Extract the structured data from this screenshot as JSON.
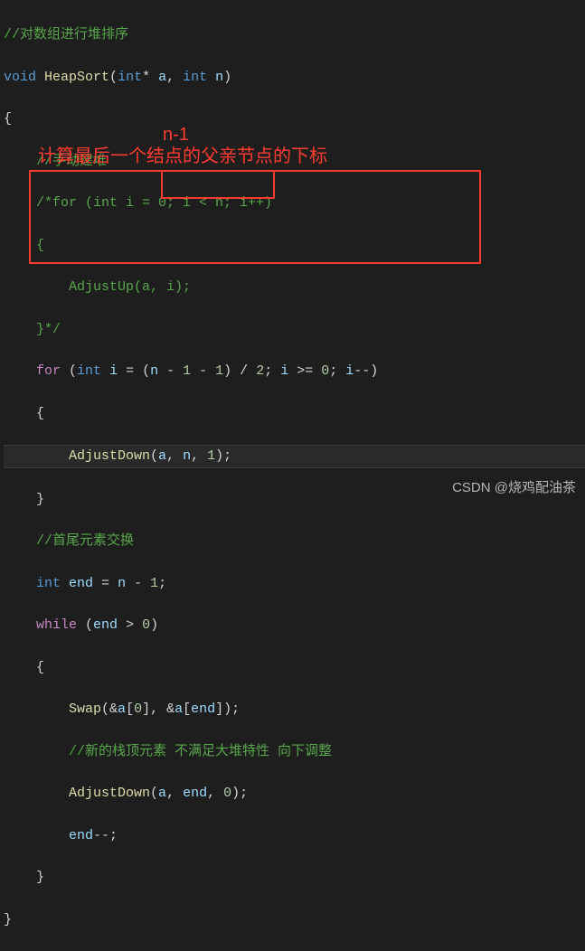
{
  "annotations": {
    "nminus1": "n-1",
    "father_index": "计算最后一个结点的父亲节点的下标"
  },
  "code": {
    "l1_comment": "//对数组进行堆排序",
    "l2_void": "void",
    "l2_func": "HeapSort",
    "l2_int": "int",
    "l2_params": "(",
    "l2_star": "* ",
    "l2_a": "a",
    "l2_comma": ", ",
    "l2_n": "n",
    "l2_close": ")",
    "l3": "{",
    "l4_comment": "//手动建堆",
    "l5_comment": "/*for (int i = 0; i < n; i++)",
    "l6_comment": "{",
    "l7_comment": "    AdjustUp(a, i);",
    "l8_comment": "}*/",
    "l9_for": "for",
    "l9_open": " (",
    "l9_int": "int",
    "l9_i": " i ",
    "l9_eq": "= (",
    "l9_n": "n ",
    "l9_m1": "- ",
    "l9_one": "1 ",
    "l9_m2": "- ",
    "l9_one2": "1",
    "l9_cp": ") / ",
    "l9_two": "2",
    "l9_semi": "; ",
    "l9_i2": "i ",
    "l9_ge": ">= ",
    "l9_zero": "0",
    "l9_semi2": "; ",
    "l9_i3": "i",
    "l9_dec": "--)",
    "l10": "{",
    "l11_func": "AdjustDown",
    "l11_open": "(",
    "l11_a": "a",
    "l11_c1": ", ",
    "l11_n": "n",
    "l11_c2": ", ",
    "l11_one": "1",
    "l11_close": ");",
    "l12": "}",
    "l13_comment": "//首尾元素交换",
    "l14_int": "int",
    "l14_end": " end ",
    "l14_eq": "= ",
    "l14_n": "n ",
    "l14_m": "- ",
    "l14_one": "1",
    "l14_semi": ";",
    "l15_while": "while",
    "l15_open": " (",
    "l15_end": "end ",
    "l15_gt": "> ",
    "l15_zero": "0",
    "l15_close": ")",
    "l16": "{",
    "l17_func": "Swap",
    "l17_open": "(&",
    "l17_a1": "a",
    "l17_br1": "[",
    "l17_zero": "0",
    "l17_br2": "], &",
    "l17_a2": "a",
    "l17_br3": "[",
    "l17_end": "end",
    "l17_br4": "]);",
    "l18_comment": "//新的栈顶元素 不满足大堆特性 向下调整",
    "l19_func": "AdjustDown",
    "l19_open": "(",
    "l19_a": "a",
    "l19_c1": ", ",
    "l19_end": "end",
    "l19_c2": ", ",
    "l19_zero": "0",
    "l19_close": ");",
    "l20_end": "end",
    "l20_dec": "--;",
    "l21": "}",
    "l22": "}"
  },
  "watermark": "CSDN @烧鸡配油茶"
}
